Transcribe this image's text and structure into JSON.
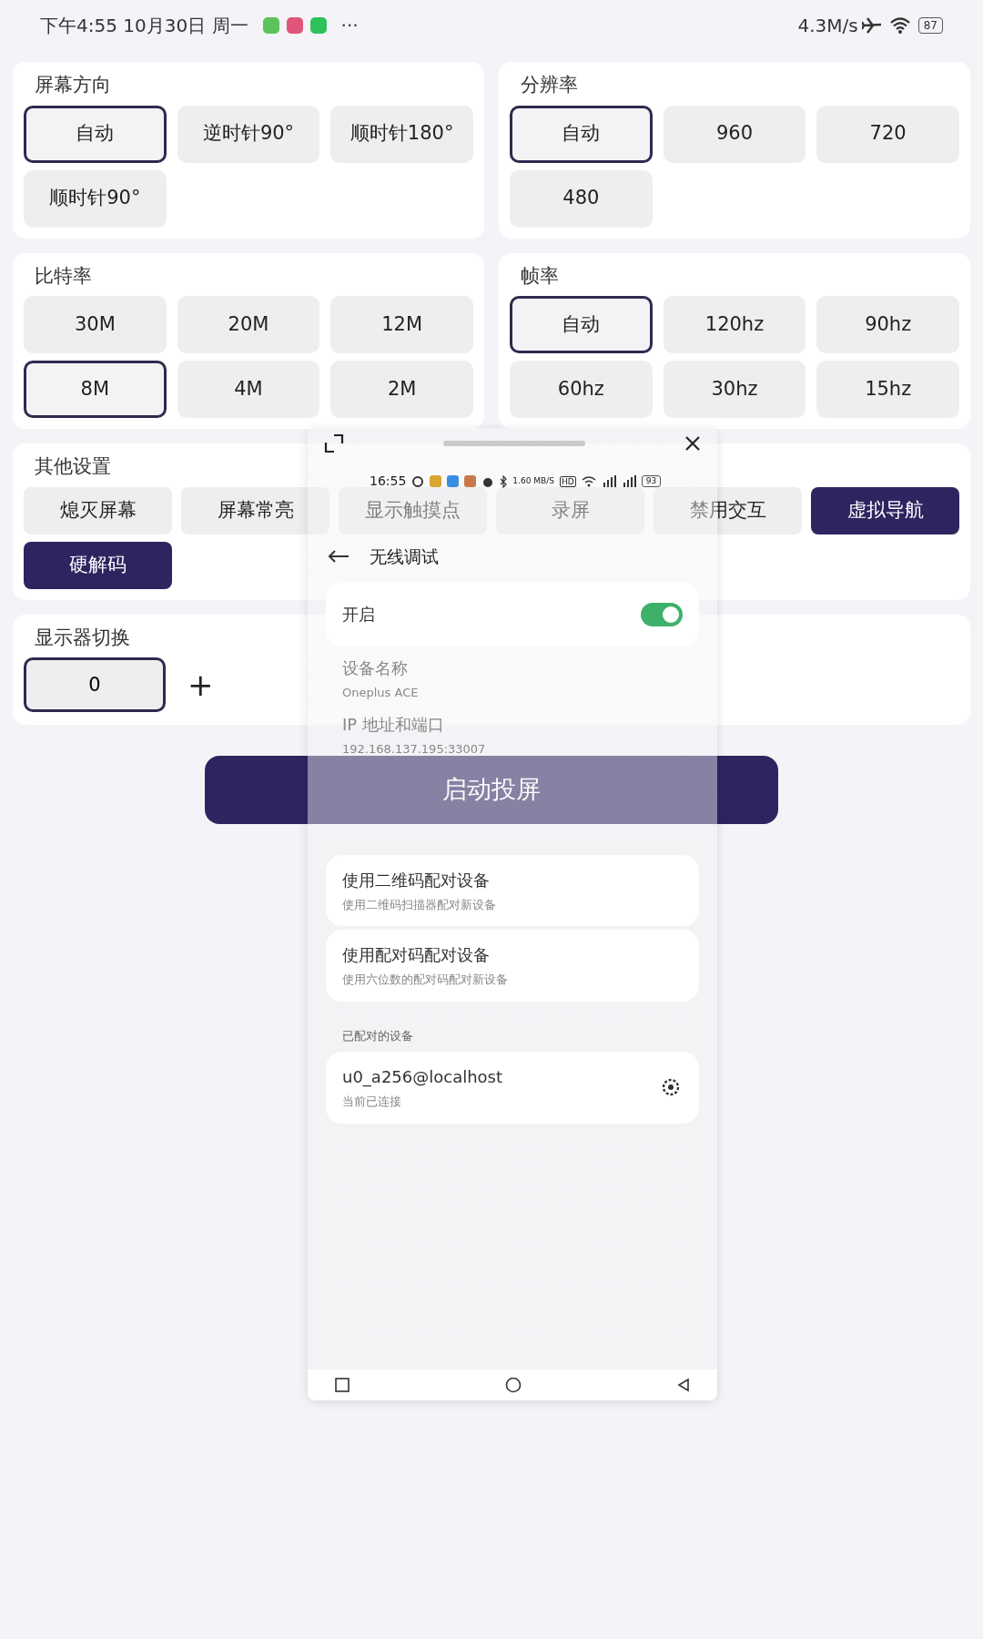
{
  "status_bar": {
    "time": "下午4:55 10月30日 周一",
    "more": "···",
    "speed": "4.3M/s",
    "battery": "87"
  },
  "settings": [
    {
      "title": "屏幕方向",
      "options": [
        {
          "label": "自动",
          "selected": true
        },
        {
          "label": "逆时针90°",
          "selected": false
        },
        {
          "label": "顺时针180°",
          "selected": false
        },
        {
          "label": "顺时针90°",
          "selected": false
        }
      ]
    },
    {
      "title": "分辨率",
      "options": [
        {
          "label": "自动",
          "selected": true
        },
        {
          "label": "960",
          "selected": false
        },
        {
          "label": "720",
          "selected": false
        },
        {
          "label": "480",
          "selected": false
        }
      ]
    },
    {
      "title": "比特率",
      "options": [
        {
          "label": "30M",
          "selected": false
        },
        {
          "label": "20M",
          "selected": false
        },
        {
          "label": "12M",
          "selected": false
        },
        {
          "label": "8M",
          "selected": true
        },
        {
          "label": "4M",
          "selected": false
        },
        {
          "label": "2M",
          "selected": false
        }
      ]
    },
    {
      "title": "帧率",
      "options": [
        {
          "label": "自动",
          "selected": true
        },
        {
          "label": "120hz",
          "selected": false
        },
        {
          "label": "90hz",
          "selected": false
        },
        {
          "label": "60hz",
          "selected": false
        },
        {
          "label": "30hz",
          "selected": false
        },
        {
          "label": "15hz",
          "selected": false
        }
      ]
    }
  ],
  "other_settings": {
    "title": "其他设置",
    "toggles": [
      {
        "label": "熄灭屏幕",
        "on": false
      },
      {
        "label": "屏幕常亮",
        "on": false
      },
      {
        "label": "显示触摸点",
        "on": false
      },
      {
        "label": "录屏",
        "on": false
      },
      {
        "label": "禁用交互",
        "on": false
      },
      {
        "label": "虚拟导航",
        "on": true
      },
      {
        "label": "硬解码",
        "on": true
      }
    ]
  },
  "display_switch": {
    "title": "显示器切换",
    "value": "0",
    "add": "+"
  },
  "start_button": "启动投屏",
  "floating_window": {
    "phone_status": {
      "time": "16:55",
      "speed": "1.60",
      "speed_unit": "MB/S",
      "hd": "HD",
      "battery": "93"
    },
    "title": "无线调试",
    "enable": {
      "label": "开启",
      "on": true
    },
    "items": [
      {
        "kind": "info",
        "title": "设备名称",
        "subtitle": "Oneplus ACE"
      },
      {
        "kind": "info",
        "title": "IP 地址和端口",
        "subtitle": "192.168.137.195:33007"
      },
      {
        "kind": "action",
        "title": "使用二维码配对设备",
        "subtitle": "使用二维码扫描器配对新设备"
      },
      {
        "kind": "action",
        "title": "使用配对码配对设备",
        "subtitle": "使用六位数的配对码配对新设备"
      }
    ],
    "paired_header": "已配对的设备",
    "paired": [
      {
        "name": "u0_a256@localhost",
        "status": "当前已连接"
      }
    ]
  }
}
